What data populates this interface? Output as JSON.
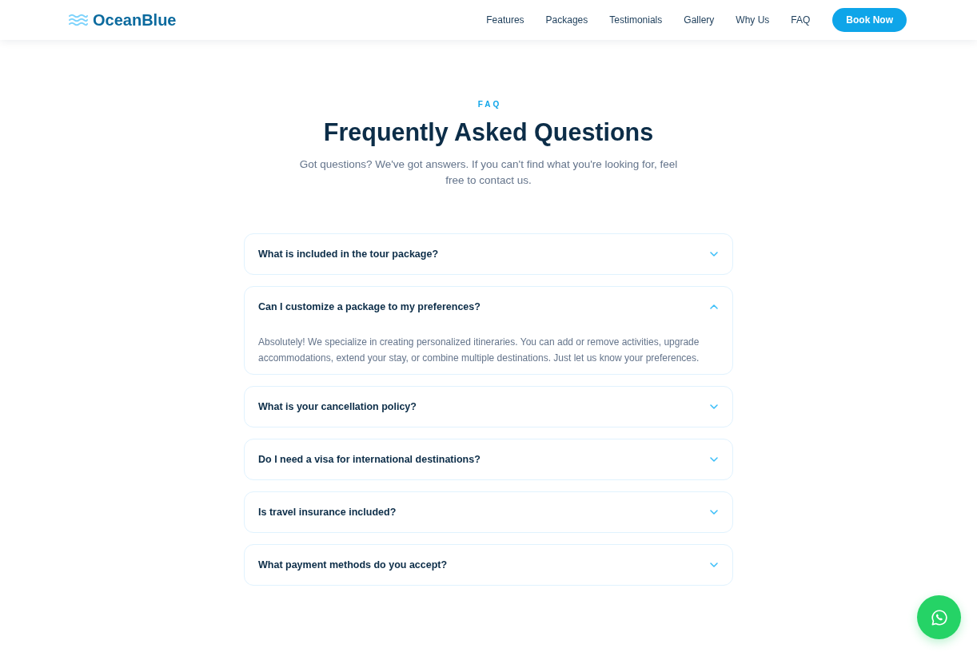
{
  "header": {
    "logo": "OceanBlue",
    "nav": [
      "Features",
      "Packages",
      "Testimonials",
      "Gallery",
      "Why Us",
      "FAQ"
    ],
    "cta": "Book Now"
  },
  "faq_section": {
    "eyebrow": "FAQ",
    "title": "Frequently Asked Questions",
    "subtitle": "Got questions? We've got answers. If you can't find what you're looking for, feel free to contact us.",
    "items": [
      {
        "question": "What is included in the tour package?",
        "expanded": false
      },
      {
        "question": "Can I customize a package to my preferences?",
        "expanded": true,
        "answer": "Absolutely! We specialize in creating personalized itineraries. You can add or remove activities, upgrade accommodations, extend your stay, or combine multiple destinations. Just let us know your preferences."
      },
      {
        "question": "What is your cancellation policy?",
        "expanded": false
      },
      {
        "question": "Do I need a visa for international destinations?",
        "expanded": false
      },
      {
        "question": "Is travel insurance included?",
        "expanded": false
      },
      {
        "question": "What payment methods do you accept?",
        "expanded": false
      }
    ]
  }
}
